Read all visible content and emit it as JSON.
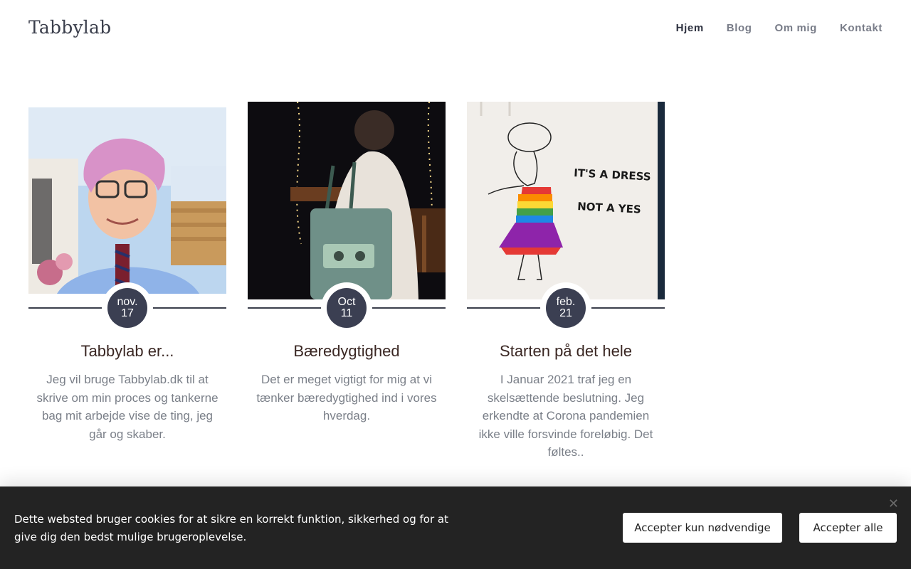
{
  "header": {
    "site_title": "Tabbylab",
    "nav": [
      {
        "label": "Hjem",
        "active": true
      },
      {
        "label": "Blog",
        "active": false
      },
      {
        "label": "Om mig",
        "active": false
      },
      {
        "label": "Kontakt",
        "active": false
      }
    ]
  },
  "posts": [
    {
      "date_month": "nov.",
      "date_day": "17",
      "title": "Tabbylab er...",
      "excerpt": "Jeg vil bruge Tabbylab.dk til at skrive om min proces og tankerne bag mit arbejde vise de ting, jeg går og skaber."
    },
    {
      "date_month": "Oct",
      "date_day": "11",
      "title": "Bæredygtighed",
      "excerpt": "Det er meget vigtigt for mig at vi tænker bæredygtighed ind i vores hverdag."
    },
    {
      "date_month": "feb.",
      "date_day": "21",
      "title": "Starten på det hele",
      "excerpt": "I Januar 2021 traf jeg en skelsættende beslutning. Jeg erkendte at Corona pandemien ikke ville forsvinde foreløbig. Det føltes..",
      "image_text_line1": "IT'S A DRESS",
      "image_text_line2": "NOT A YES"
    }
  ],
  "cookie": {
    "text": "Dette websted bruger cookies for at sikre en korrekt funktion, sikkerhed og for at give dig den bedst mulige brugeroplevelse.",
    "close": "✕",
    "btn_necessary": "Accepter kun nødvendige",
    "btn_all": "Accepter alle"
  },
  "colors": {
    "accent_dark": "#3b3f52",
    "cookie_bg": "#232323"
  }
}
